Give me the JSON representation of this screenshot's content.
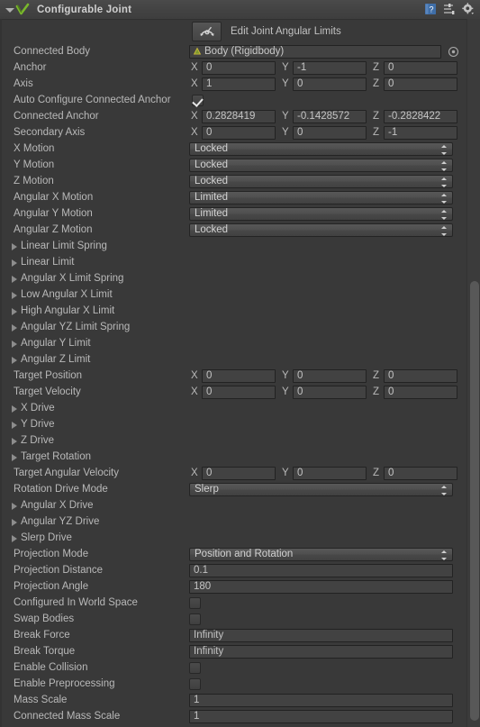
{
  "component": {
    "title": "Configurable Joint",
    "icon": "joint-icon",
    "foldout_expanded": true,
    "header_buttons": [
      {
        "name": "help-icon",
        "label": "?"
      },
      {
        "name": "preset-icon",
        "label": ""
      },
      {
        "name": "settings-gear-icon",
        "label": ""
      }
    ]
  },
  "edit_tool": {
    "icon": "edit-angular-limits-icon",
    "label": "Edit Joint Angular Limits"
  },
  "fields": {
    "connected_body": {
      "label": "Connected Body",
      "value": "Body (Rigidbody)",
      "thumb_icon": "rigidbody-icon",
      "picker_icon": "object-picker-icon"
    },
    "anchor": {
      "label": "Anchor",
      "x": "0",
      "y": "-1",
      "z": "0"
    },
    "axis": {
      "label": "Axis",
      "x": "1",
      "y": "0",
      "z": "0"
    },
    "auto_configure_connected_anchor": {
      "label": "Auto Configure Connected Anchor",
      "checked": true
    },
    "connected_anchor": {
      "label": "Connected Anchor",
      "x": "0.2828419",
      "y": "-0.1428572",
      "z": "-0.2828422"
    },
    "secondary_axis": {
      "label": "Secondary Axis",
      "x": "0",
      "y": "0",
      "z": "-1"
    },
    "x_motion": {
      "label": "X Motion",
      "value": "Locked"
    },
    "y_motion": {
      "label": "Y Motion",
      "value": "Locked"
    },
    "z_motion": {
      "label": "Z Motion",
      "value": "Locked"
    },
    "angular_x_motion": {
      "label": "Angular X Motion",
      "value": "Limited"
    },
    "angular_y_motion": {
      "label": "Angular Y Motion",
      "value": "Limited"
    },
    "angular_z_motion": {
      "label": "Angular Z Motion",
      "value": "Locked"
    },
    "linear_limit_spring": {
      "label": "Linear Limit Spring"
    },
    "linear_limit": {
      "label": "Linear Limit"
    },
    "angular_x_limit_spring": {
      "label": "Angular X Limit Spring"
    },
    "low_angular_x_limit": {
      "label": "Low Angular X Limit"
    },
    "high_angular_x_limit": {
      "label": "High Angular X Limit"
    },
    "angular_yz_limit_spring": {
      "label": "Angular YZ Limit Spring"
    },
    "angular_y_limit": {
      "label": "Angular Y Limit"
    },
    "angular_z_limit": {
      "label": "Angular Z Limit"
    },
    "target_position": {
      "label": "Target Position",
      "x": "0",
      "y": "0",
      "z": "0"
    },
    "target_velocity": {
      "label": "Target Velocity",
      "x": "0",
      "y": "0",
      "z": "0"
    },
    "x_drive": {
      "label": "X Drive"
    },
    "y_drive": {
      "label": "Y Drive"
    },
    "z_drive": {
      "label": "Z Drive"
    },
    "target_rotation": {
      "label": "Target Rotation"
    },
    "target_angular_velocity": {
      "label": "Target Angular Velocity",
      "x": "0",
      "y": "0",
      "z": "0"
    },
    "rotation_drive_mode": {
      "label": "Rotation Drive Mode",
      "value": "Slerp"
    },
    "angular_x_drive": {
      "label": "Angular X Drive"
    },
    "angular_yz_drive": {
      "label": "Angular YZ Drive"
    },
    "slerp_drive": {
      "label": "Slerp Drive"
    },
    "projection_mode": {
      "label": "Projection Mode",
      "value": "Position and Rotation"
    },
    "projection_distance": {
      "label": "Projection Distance",
      "value": "0.1"
    },
    "projection_angle": {
      "label": "Projection Angle",
      "value": "180"
    },
    "configured_in_world_space": {
      "label": "Configured In World Space",
      "checked": false
    },
    "swap_bodies": {
      "label": "Swap Bodies",
      "checked": false
    },
    "break_force": {
      "label": "Break Force",
      "value": "Infinity"
    },
    "break_torque": {
      "label": "Break Torque",
      "value": "Infinity"
    },
    "enable_collision": {
      "label": "Enable Collision",
      "checked": false
    },
    "enable_preprocessing": {
      "label": "Enable Preprocessing",
      "checked": false
    },
    "mass_scale": {
      "label": "Mass Scale",
      "value": "1"
    },
    "connected_mass_scale": {
      "label": "Connected Mass Scale",
      "value": "1"
    }
  },
  "axis_labels": {
    "x": "X",
    "y": "Y",
    "z": "Z"
  },
  "colors": {
    "panel_bg": "#393939",
    "header_bg": "#434343",
    "field_bg": "#424242",
    "text": "#b9b9b9",
    "accent_green": "#8bc34a"
  }
}
